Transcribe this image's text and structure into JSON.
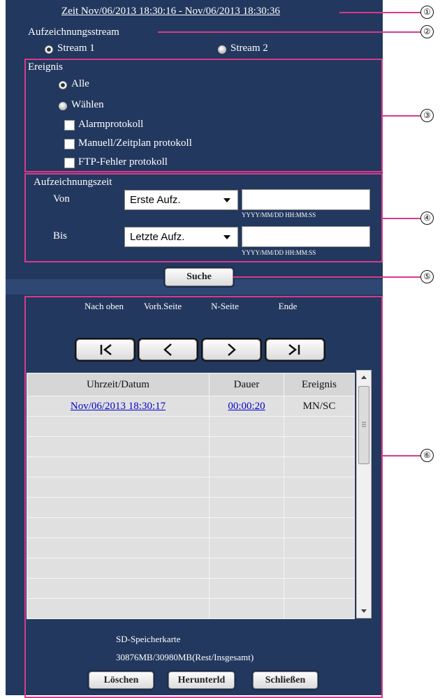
{
  "header": {
    "time_range": "Zeit Nov/06/2013 18:30:16 - Nov/06/2013 18:30:36"
  },
  "stream": {
    "title": "Aufzeichnungsstream",
    "option1": "Stream 1",
    "option2": "Stream 2",
    "selected": "Stream 1"
  },
  "event": {
    "title": "Ereignis",
    "all": "Alle",
    "select": "Wählen",
    "selected": "Alle",
    "checks": [
      "Alarmprotokoll",
      "Manuell/Zeitplan protokoll",
      "FTP-Fehler protokoll"
    ]
  },
  "rec_time": {
    "title": "Aufzeichnungszeit",
    "from_label": "Von",
    "from_value": "Erste Aufz.",
    "to_label": "Bis",
    "to_value": "Letzte Aufz.",
    "format_hint": "YYYY/MM/DD HH:MM:SS"
  },
  "search_label": "Suche",
  "nav": {
    "top": "Nach oben",
    "prev": "Vorh.Seite",
    "next": "N-Seite",
    "end": "Ende"
  },
  "table": {
    "columns": [
      "Uhrzeit/Datum",
      "Dauer",
      "Ereignis"
    ],
    "rows": [
      {
        "datetime": "Nov/06/2013  18:30:17",
        "duration": "00:00:20",
        "event": "MN/SC"
      }
    ]
  },
  "sd": {
    "label": "SD-Speicherkarte",
    "capacity": "30876MB/30980MB(Rest/Insgesamt)"
  },
  "buttons": {
    "delete": "Löschen",
    "download": "Herunterld",
    "close": "Schließen"
  },
  "callouts": [
    "①",
    "②",
    "③",
    "④",
    "⑤",
    "⑥"
  ],
  "colors": {
    "panel": "#22385e",
    "marker": "#d83a8c",
    "link": "#0000cc"
  }
}
